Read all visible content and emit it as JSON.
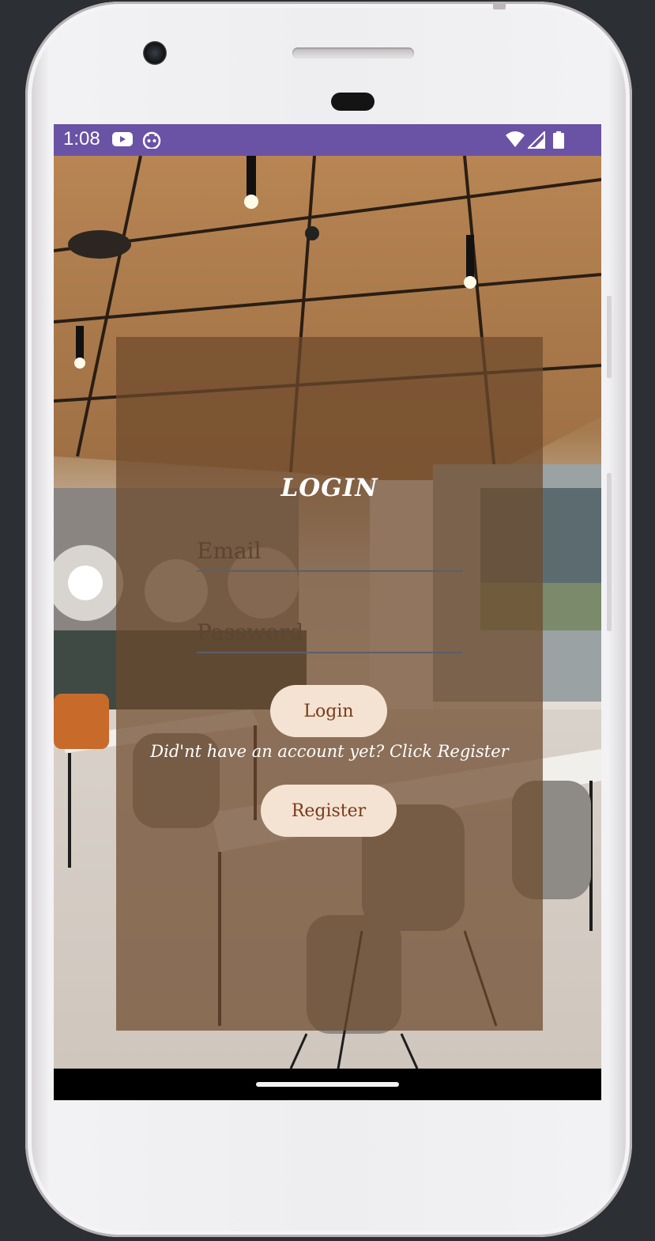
{
  "status_bar": {
    "time": "1:08",
    "background": "#6a52a5",
    "icons": [
      "youtube-icon",
      "notification-bot-icon",
      "wifi-icon",
      "signal-icon",
      "battery-icon"
    ]
  },
  "login": {
    "title": "LOGIN",
    "email_placeholder": "Email",
    "password_placeholder": "Password",
    "login_button": "Login",
    "register_hint": "Did'nt have an account yet? Click Register",
    "register_button": "Register"
  },
  "colors": {
    "card_overlay": "#6e4a2c",
    "button_bg": "#f4e3d3",
    "button_text": "#7a3a1a"
  }
}
